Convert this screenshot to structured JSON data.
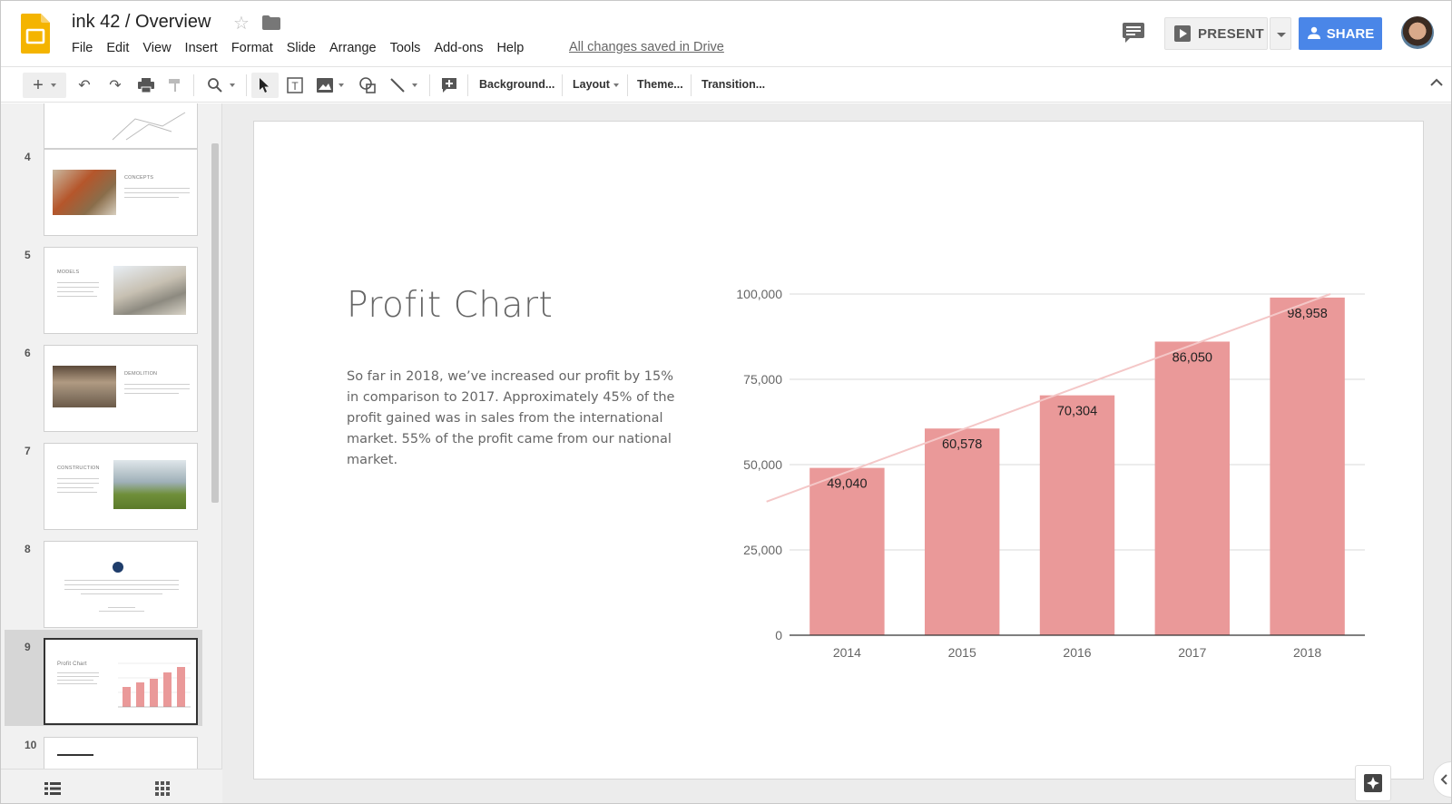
{
  "header": {
    "title": "ink 42 / Overview",
    "star_icon": "star-icon",
    "folder_icon": "folder-icon",
    "menu": [
      "File",
      "Edit",
      "View",
      "Insert",
      "Format",
      "Slide",
      "Arrange",
      "Tools",
      "Add-ons",
      "Help"
    ],
    "save_status": "All changes saved in Drive",
    "present_label": "PRESENT",
    "share_label": "SHARE"
  },
  "toolbar": {
    "background_label": "Background...",
    "layout_label": "Layout",
    "theme_label": "Theme...",
    "transition_label": "Transition..."
  },
  "filmstrip": {
    "slides": [
      {
        "number": "4",
        "heading": "CONCEPTS"
      },
      {
        "number": "5",
        "heading": "MODELS"
      },
      {
        "number": "6",
        "heading": "DEMOLITION"
      },
      {
        "number": "7",
        "heading": "CONSTRUCTION"
      },
      {
        "number": "8",
        "heading": ""
      },
      {
        "number": "9",
        "heading": "Profit Chart"
      },
      {
        "number": "10",
        "heading": ""
      }
    ],
    "selected": "9"
  },
  "slide": {
    "title": "Profit Chart",
    "body": "So far in 2018, we’ve increased our profit by 15% in comparison to 2017. Approximately 45% of the profit gained was in sales from the international market. 55% of the profit came from our national market."
  },
  "chart_data": {
    "type": "bar",
    "categories": [
      "2014",
      "2015",
      "2016",
      "2017",
      "2018"
    ],
    "values": [
      49040,
      60578,
      70304,
      86050,
      98958
    ],
    "data_labels": [
      "49,040",
      "60,578",
      "70,304",
      "86,050",
      "98,958"
    ],
    "y_ticks": [
      "0",
      "25,000",
      "50,000",
      "75,000",
      "100,000"
    ],
    "ylim": [
      0,
      100000
    ],
    "trendline": true,
    "grid": true,
    "bar_color": "#ea9999",
    "trend_color": "#f4c7c7"
  },
  "colors": {
    "share_blue": "#4a86e8",
    "slides_yellow": "#f4b400"
  }
}
